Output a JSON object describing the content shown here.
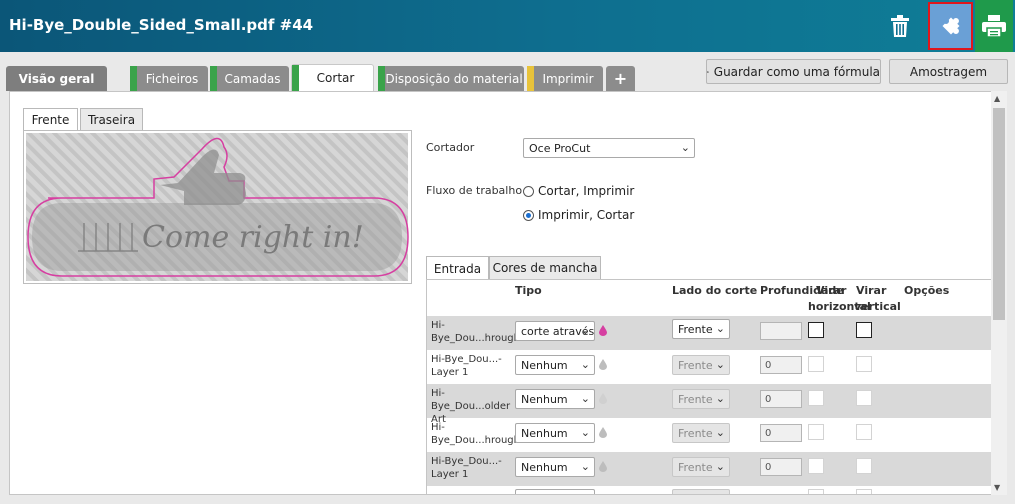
{
  "header": {
    "title": "Hi-Bye_Double_Sided_Small.pdf #44",
    "colors": {
      "accent_puzzle": "#6aa0d6",
      "highlight_border": "#e0161c",
      "print_green": "#1f9a4b"
    }
  },
  "tabs": {
    "overview": "Visão geral",
    "items": [
      {
        "label": "Ficheiros",
        "stripe": "#3aa34a"
      },
      {
        "label": "Camadas",
        "stripe": "#3aa34a"
      },
      {
        "label": "Cortar",
        "stripe": "#3aa34a"
      },
      {
        "label": "Disposição do material",
        "stripe": "#3aa34a"
      },
      {
        "label": "Imprimir",
        "stripe": "#e8c33a"
      }
    ],
    "add": "+"
  },
  "actions": {
    "save_formula": "Guardar como uma fórmula",
    "sampling": "Amostragem"
  },
  "preview": {
    "tabs": [
      "Frente",
      "Traseira"
    ],
    "artwork_text": "Come right in!"
  },
  "form": {
    "cutter_label": "Cortador",
    "cutter_value": "Oce ProCut",
    "workflow_label": "Fluxo de trabalho",
    "workflow_options": [
      "Cortar, Imprimir",
      "Imprimir, Cortar"
    ],
    "workflow_selected": 1
  },
  "inner_tabs": [
    "Entrada",
    "Cores de mancha"
  ],
  "table": {
    "headers": {
      "tipo": "Tipo",
      "lado": "Lado do corte",
      "profundidade": "Profundidade",
      "virar_h1": "Virar",
      "virar_h2": "horizontal",
      "virar_v1": "Virar",
      "virar_v2": "vertical",
      "opcoes": "Opções"
    },
    "rows": [
      {
        "name1": "Hi-",
        "name2": "Bye_Dou...hroughcut",
        "tipo": "corte através",
        "lado": "Frente",
        "depth": "",
        "enabled": true,
        "drop": "#d63fa1"
      },
      {
        "name1": "Hi-Bye_Dou...-",
        "name2": "Layer 1",
        "tipo": "Nenhum",
        "lado": "Frente",
        "depth": "0",
        "enabled": false,
        "drop": "#bdbdbd"
      },
      {
        "name1": "Hi-Bye_Dou...older",
        "name2": "Art",
        "tipo": "Nenhum",
        "lado": "Frente",
        "depth": "0",
        "enabled": false,
        "drop": "#d0d0d0"
      },
      {
        "name1": "Hi-",
        "name2": "Bye_Dou...hroughcut",
        "tipo": "Nenhum",
        "lado": "Frente",
        "depth": "0",
        "enabled": false,
        "drop": "#bdbdbd"
      },
      {
        "name1": "Hi-Bye_Dou...-",
        "name2": "Layer 1",
        "tipo": "Nenhum",
        "lado": "Frente",
        "depth": "0",
        "enabled": false,
        "drop": "#bdbdbd"
      }
    ]
  }
}
